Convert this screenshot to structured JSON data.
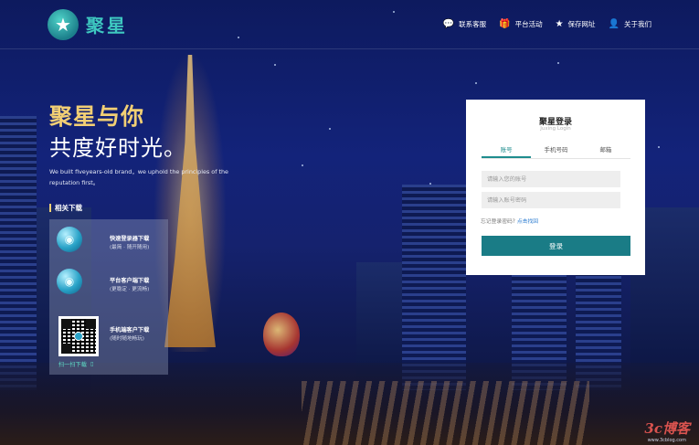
{
  "header": {
    "logo_text": "聚星",
    "logo_icon": "star-icon",
    "nav": [
      {
        "label": "联系客服",
        "icon": "chat-bubble-icon"
      },
      {
        "label": "平台活动",
        "icon": "gift-icon"
      },
      {
        "label": "保存网址",
        "icon": "star-icon"
      },
      {
        "label": "关于我们",
        "icon": "user-badge-icon"
      }
    ]
  },
  "hero": {
    "slogan_line1": "聚星与你",
    "slogan_line2": "共度好时光。",
    "tagline": "We built fiveyears-old brand，we uphold the principles of the reputation first。"
  },
  "downloads": {
    "title": "相关下载",
    "items": [
      {
        "name": "快速登录器下载",
        "sub": "(最简 · 随开随用)"
      },
      {
        "name": "平台客户端下载",
        "sub": "(更稳定 · 更流畅)"
      },
      {
        "name": "手机端客户下载",
        "sub": "(随时随地畅玩)"
      }
    ],
    "scan_label": "扫一扫下载"
  },
  "login": {
    "title": "聚星登录",
    "subtitle": "Juxing Login",
    "tabs": [
      "账号",
      "手机号码",
      "邮箱"
    ],
    "active_tab": "账号",
    "account_placeholder": "请输入您的账号",
    "password_placeholder": "请输入账号密码",
    "forgot_text": "忘记登录密码?",
    "forgot_link": "点击找回",
    "submit_label": "登录"
  },
  "watermark": {
    "text": "3c博客",
    "sub": "www.3cblog.com"
  },
  "colors": {
    "accent": "#1a7c86",
    "brand_teal": "#3ec8c0",
    "slogan_gold": "#f2cf74",
    "link_blue": "#2a7bd0"
  }
}
